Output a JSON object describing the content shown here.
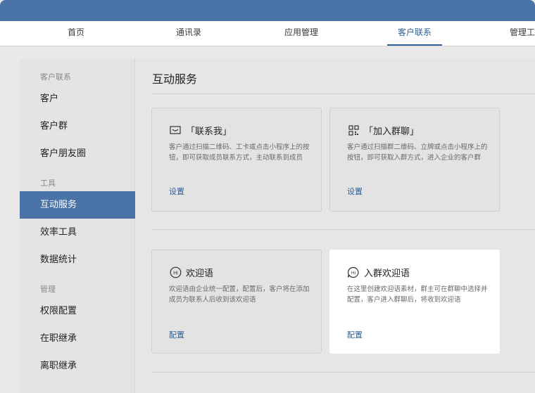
{
  "nav": {
    "items": [
      {
        "label": "首页"
      },
      {
        "label": "通讯录"
      },
      {
        "label": "应用管理"
      },
      {
        "label": "客户联系",
        "active": true
      },
      {
        "label": "管理工"
      }
    ]
  },
  "sidebar": {
    "groups": [
      {
        "title": "客户联系",
        "items": [
          "客户",
          "客户群",
          "客户朋友圈"
        ]
      },
      {
        "title": "工具",
        "items": [
          "互动服务",
          "效率工具",
          "数据统计"
        ]
      },
      {
        "title": "管理",
        "items": [
          "权限配置",
          "在职继承",
          "离职继承"
        ]
      }
    ],
    "active_item": "互动服务"
  },
  "main": {
    "title": "互动服务",
    "cards": [
      {
        "icon": "chat-icon",
        "title": "「联系我」",
        "desc": "客户通过扫描二维码、工卡或点击小程序上的按钮，即可获取成员联系方式，主动联系到成员",
        "action": "设置"
      },
      {
        "icon": "qr-code-icon",
        "title": "「加入群聊」",
        "desc": "客户通过扫描群二维码、立牌或点击小程序上的按钮，即可获取入群方式，进入企业的客户群",
        "action": "设置"
      },
      {
        "icon": "hi-icon",
        "title": "欢迎语",
        "desc": "欢迎语由企业统一配置，配置后，客户将在添加成员为联系人后收到该欢迎语",
        "action": "配置"
      },
      {
        "icon": "hi-bubble-icon",
        "title": "入群欢迎语",
        "desc": "在这里创建欢迎语素材，群主可在群聊中选择并配置，客户进入群聊后，将收到欢迎语",
        "action": "配置",
        "highlighted": true
      }
    ]
  },
  "colors": {
    "accent": "#4a74a8",
    "link": "#2d5f9a"
  }
}
